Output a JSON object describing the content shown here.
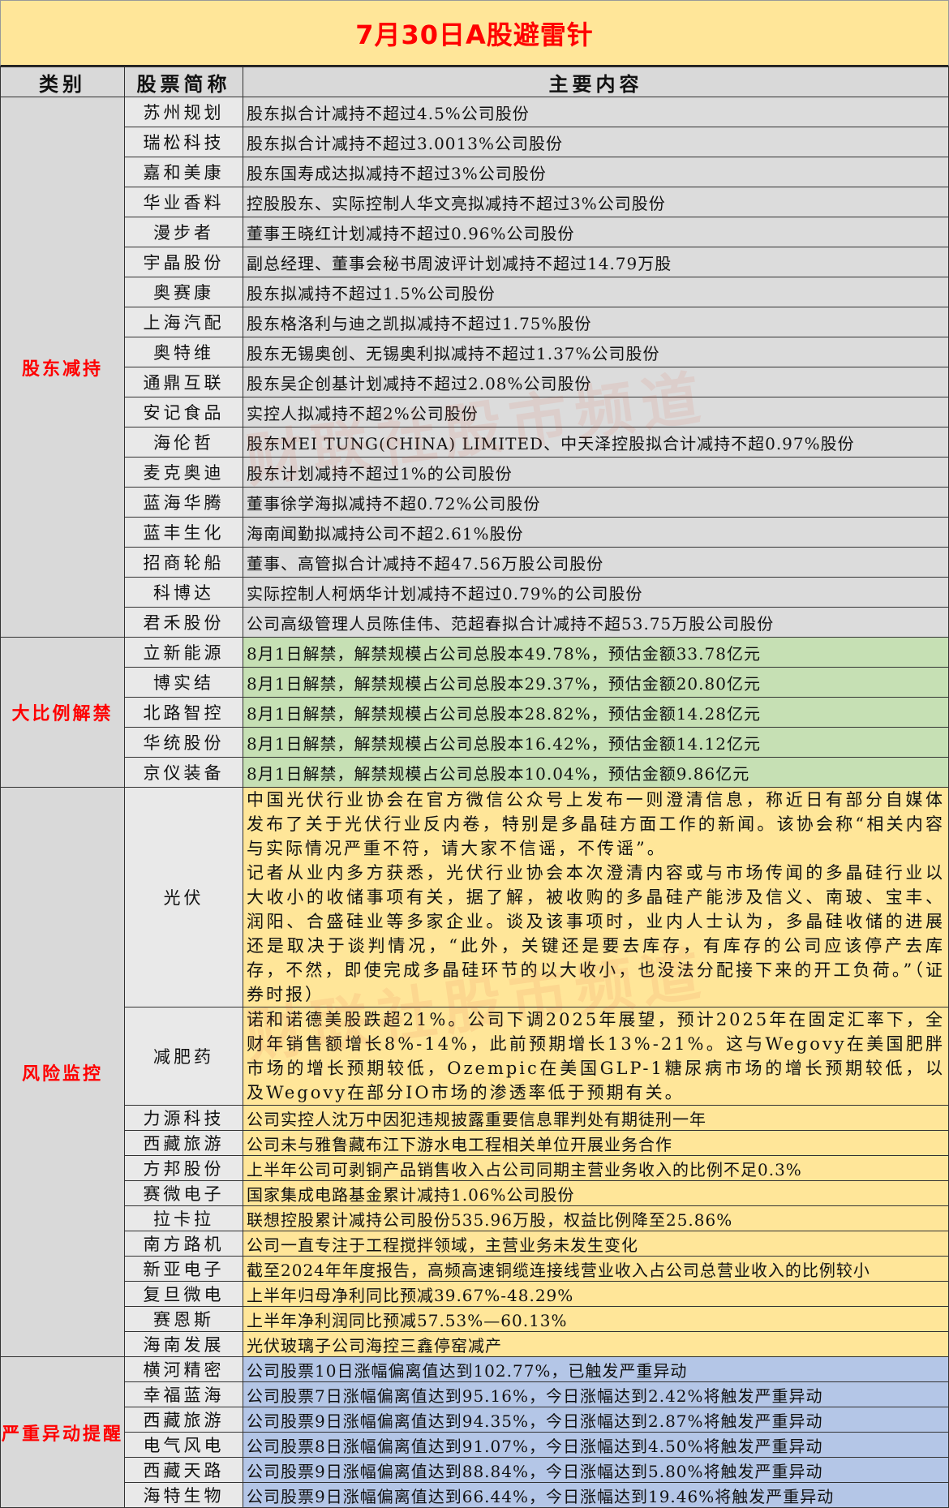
{
  "title": "7月30日A股避雷针",
  "headers": [
    "类别",
    "股票简称",
    "主要内容"
  ],
  "watermark": "财联社股市频道",
  "colors": {
    "title_bg": "#FFE699",
    "header_bg": "#D9D9D9",
    "reduce_bg": "#DCDCDC",
    "unlock_bg": "#C6E0B4",
    "risk_bg": "#FFE699",
    "abnormal_bg": "#B4C6E7",
    "category_text": "#FF0000"
  },
  "sections": [
    {
      "category": "股东减持",
      "rows": [
        {
          "name": "苏州规划",
          "content": "股东拟合计减持不超过4.5%公司股份"
        },
        {
          "name": "瑞松科技",
          "content": "股东拟合计减持不超过3.0013%公司股份"
        },
        {
          "name": "嘉和美康",
          "content": "股东国寿成达拟减持不超过3%公司股份"
        },
        {
          "name": "华业香料",
          "content": "控股股东、实际控制人华文亮拟减持不超过3%公司股份"
        },
        {
          "name": "漫步者",
          "content": "董事王晓红计划减持不超过0.96%公司股份"
        },
        {
          "name": "宇晶股份",
          "content": "副总经理、董事会秘书周波评计划减持不超过14.79万股"
        },
        {
          "name": "奥赛康",
          "content": "股东拟减持不超过1.5%公司股份"
        },
        {
          "name": "上海汽配",
          "content": "股东格洛利与迪之凯拟减持不超过1.75%股份"
        },
        {
          "name": "奥特维",
          "content": "股东无锡奥创、无锡奥利拟减持不超过1.37%公司股份"
        },
        {
          "name": "通鼎互联",
          "content": "股东吴企创基计划减持不超过2.08%公司股份"
        },
        {
          "name": "安记食品",
          "content": "实控人拟减持不超2%公司股份"
        },
        {
          "name": "海伦哲",
          "content": "股东MEI TUNG(CHINA) LIMITED、中天泽控股拟合计减持不超0.97%股份"
        },
        {
          "name": "麦克奥迪",
          "content": "股东计划减持不超过1%的公司股份"
        },
        {
          "name": "蓝海华腾",
          "content": "董事徐学海拟减持不超0.72%公司股份"
        },
        {
          "name": "蓝丰生化",
          "content": "海南闻勤拟减持公司不超2.61%股份"
        },
        {
          "name": "招商轮船",
          "content": "董事、高管拟合计减持不超47.56万股公司股份"
        },
        {
          "name": "科博达",
          "content": "实际控制人柯炳华计划减持不超过0.79%的公司股份"
        },
        {
          "name": "君禾股份",
          "content": "公司高级管理人员陈佳伟、范超春拟合计减持不超53.75万股公司股份"
        }
      ]
    },
    {
      "category": "大比例解禁",
      "rows": [
        {
          "name": "立新能源",
          "content": "8月1日解禁，解禁规模占公司总股本49.78%，预估金额33.78亿元"
        },
        {
          "name": "博实结",
          "content": "8月1日解禁，解禁规模占公司总股本29.37%，预估金额20.80亿元"
        },
        {
          "name": "北路智控",
          "content": "8月1日解禁，解禁规模占公司总股本28.82%，预估金额14.28亿元"
        },
        {
          "name": "华统股份",
          "content": "8月1日解禁，解禁规模占公司总股本16.42%，预估金额14.12亿元"
        },
        {
          "name": "京仪装备",
          "content": "8月1日解禁，解禁规模占公司总股本10.04%，预估金额9.86亿元"
        }
      ]
    },
    {
      "category": "风险监控",
      "rows": [
        {
          "name": "光伏",
          "content": "中国光伏行业协会在官方微信公众号上发布一则澄清信息，称近日有部分自媒体发布了关于光伏行业反内卷，特别是多晶硅方面工作的新闻。该协会称“相关内容与实际情况严重不符，请大家不信谣，不传谣”。",
          "content2": "记者从业内多方获悉，光伏行业协会本次澄清内容或与市场传闻的多晶硅行业以大收小的收储事项有关，据了解，被收购的多晶硅产能涉及信义、南玻、宝丰、润阳、合盛硅业等多家企业。谈及该事项时，业内人士认为，多晶硅收储的进展还是取决于谈判情况，“此外，关键还是要去库存，有库存的公司应该停产去库存，不然，即使完成多晶硅环节的以大收小，也没法分配接下来的开工负荷。”（证券时报）"
        },
        {
          "name": "减肥药",
          "content": "诺和诺德美股跌超21%。公司下调2025年展望，预计2025年在固定汇率下，全财年销售额增长8%-14%，此前预期增长13%-21%。这与Wegovy在美国肥胖市场的增长预期较低，Ozempic在美国GLP-1糖尿病市场的增长预期较低，以及Wegovy在部分IO市场的渗透率低于预期有关。"
        },
        {
          "name": "力源科技",
          "content": "公司实控人沈万中因犯违规披露重要信息罪判处有期徒刑一年"
        },
        {
          "name": "西藏旅游",
          "content": "公司未与雅鲁藏布江下游水电工程相关单位开展业务合作"
        },
        {
          "name": "方邦股份",
          "content": "上半年公司可剥铜产品销售收入占公司同期主营业务收入的比例不足0.3%"
        },
        {
          "name": "赛微电子",
          "content": "国家集成电路基金累计减持1.06%公司股份"
        },
        {
          "name": "拉卡拉",
          "content": "联想控股累计减持公司股份535.96万股，权益比例降至25.86%"
        },
        {
          "name": "南方路机",
          "content": "公司一直专注于工程搅拌领域，主营业务未发生变化"
        },
        {
          "name": "新亚电子",
          "content": "截至2024年年度报告，高频高速铜缆连接线营业收入占公司总营业收入的比例较小"
        },
        {
          "name": "复旦微电",
          "content": "上半年归母净利同比预减39.67%-48.29%"
        },
        {
          "name": "赛恩斯",
          "content": "上半年净利润同比预减57.53%—60.13%"
        },
        {
          "name": "海南发展",
          "content": "光伏玻璃子公司海控三鑫停窑减产"
        }
      ]
    },
    {
      "category": "严重异动提醒",
      "rows": [
        {
          "name": "横河精密",
          "content": "公司股票10日涨幅偏离值达到102.77%，已触发严重异动"
        },
        {
          "name": "幸福蓝海",
          "content": "公司股票7日涨幅偏离值达到95.16%，今日涨幅达到2.42%将触发严重异动"
        },
        {
          "name": "西藏旅游",
          "content": "公司股票9日涨幅偏离值达到94.35%，今日涨幅达到2.87%将触发严重异动"
        },
        {
          "name": "电气风电",
          "content": "公司股票8日涨幅偏离值达到91.07%，今日涨幅达到4.50%将触发严重异动"
        },
        {
          "name": "西藏天路",
          "content": "公司股票9日涨幅偏离值达到88.84%，今日涨幅达到5.80%将触发严重异动"
        },
        {
          "name": "海特生物",
          "content": "公司股票9日涨幅偏离值达到66.44%，今日涨幅达到19.46%将触发严重异动"
        }
      ]
    }
  ]
}
